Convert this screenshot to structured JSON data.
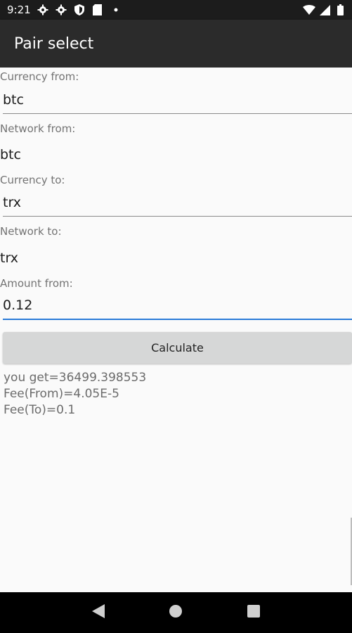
{
  "status_bar": {
    "time": "9:21",
    "left_icons": [
      "gear-icon",
      "gear-icon",
      "shield-icon",
      "sd-card-icon",
      "dot-icon"
    ],
    "right_icons": [
      "wifi-icon",
      "signal-icon",
      "battery-icon"
    ]
  },
  "app_bar": {
    "title": "Pair select"
  },
  "form": {
    "currency_from_label": "Currency from:",
    "currency_from_value": "btc",
    "network_from_label": "Network from:",
    "network_from_value": "btc",
    "currency_to_label": "Currency to:",
    "currency_to_value": "trx",
    "network_to_label": "Network to:",
    "network_to_value": "trx",
    "amount_from_label": "Amount from:",
    "amount_from_value": "0.12",
    "calculate_label": "Calculate"
  },
  "result": {
    "you_get": "you get=36499.398553",
    "fee_from": "Fee(From)=4.05E-5",
    "fee_to": "Fee(To)=0.1"
  },
  "nav": {
    "back": "back-icon",
    "home": "home-icon",
    "recents": "recents-icon"
  },
  "colors": {
    "status_bar": "#1c1c1c",
    "app_bar": "#2b2b2b",
    "focus_underline": "#2a7ad8",
    "button_bg": "#d6d7d7",
    "nav_bar": "#000000"
  }
}
